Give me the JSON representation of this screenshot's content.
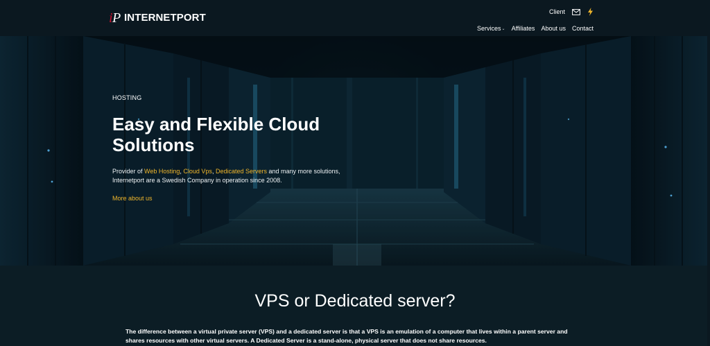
{
  "brand": {
    "mark": "iP",
    "name": "INTERNETPORT",
    "accent_color": "#c8102e"
  },
  "topbar": {
    "client_label": "Client",
    "mail_icon": "mail-icon",
    "bolt_icon": "lightning-bolt-icon",
    "bolt_color": "#f0b62b"
  },
  "nav": {
    "services_label": "Services",
    "affiliates_label": "Affiliates",
    "about_label": "About us",
    "contact_label": "Contact"
  },
  "hero": {
    "eyebrow": "HOSTING",
    "headline": "Easy and Flexible Cloud Solutions",
    "intro_prefix": "Provider of ",
    "link_web_hosting": "Web Hosting",
    "sep1": ", ",
    "link_cloud_vps": "Cloud Vps",
    "sep2": ", ",
    "link_dedicated": "Dedicated Servers",
    "intro_suffix": " and many more solutions, Internetport are a Swedish Company in operation since 2008.",
    "more_link": "More about us",
    "link_color": "#f0b62b"
  },
  "section": {
    "title": "VPS or Dedicated server?",
    "body": "The difference between a virtual private server (VPS) and a dedicated server is that a VPS is an emulation of a computer that lives within a parent server and shares resources with other virtual servers. A Dedicated Server is a stand-alone, physical server that does not share resources."
  }
}
